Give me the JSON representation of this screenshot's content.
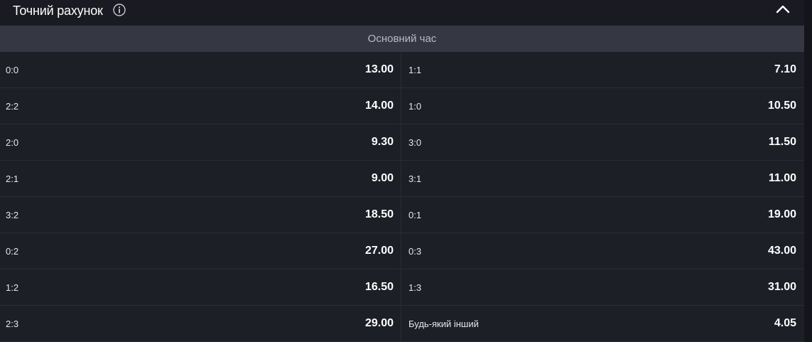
{
  "market": {
    "title": "Точний рахунок",
    "period_label": "Основний час"
  },
  "icons": {
    "info": "info-icon",
    "collapse": "chevron-up-icon"
  },
  "rows": [
    {
      "left": {
        "score": "0:0",
        "odds": "13.00"
      },
      "right": {
        "score": "1:1",
        "odds": "7.10"
      }
    },
    {
      "left": {
        "score": "2:2",
        "odds": "14.00"
      },
      "right": {
        "score": "1:0",
        "odds": "10.50"
      }
    },
    {
      "left": {
        "score": "2:0",
        "odds": "9.30"
      },
      "right": {
        "score": "3:0",
        "odds": "11.50"
      }
    },
    {
      "left": {
        "score": "2:1",
        "odds": "9.00"
      },
      "right": {
        "score": "3:1",
        "odds": "11.00"
      }
    },
    {
      "left": {
        "score": "3:2",
        "odds": "18.50"
      },
      "right": {
        "score": "0:1",
        "odds": "19.00"
      }
    },
    {
      "left": {
        "score": "0:2",
        "odds": "27.00"
      },
      "right": {
        "score": "0:3",
        "odds": "43.00"
      }
    },
    {
      "left": {
        "score": "1:2",
        "odds": "16.50"
      },
      "right": {
        "score": "1:3",
        "odds": "31.00"
      }
    },
    {
      "left": {
        "score": "2:3",
        "odds": "29.00"
      },
      "right": {
        "score": "Будь-який інший",
        "odds": "4.05"
      }
    }
  ]
}
